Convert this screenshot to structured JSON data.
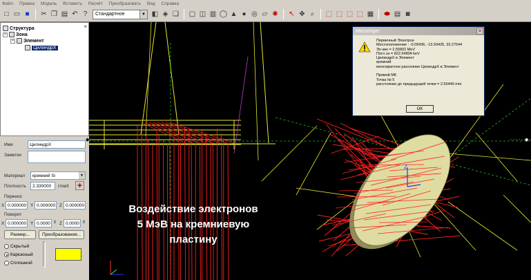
{
  "menu": [
    "Файл",
    "Правка",
    "Модель",
    "Вставить",
    "Расчёт",
    "Преобразовать",
    "Вид",
    "Справка"
  ],
  "toolbar": {
    "mode_value": "Стандартное"
  },
  "tree": {
    "root": "Структура",
    "zone": "Зона",
    "element": "Элемент",
    "cylinder": "ЦилиндрХ"
  },
  "props": {
    "name_label": "Имя",
    "name_value": "ЦилиндрХ",
    "notes_label": "Заметки",
    "notes_value": "",
    "material_label": "Материал",
    "material_value": "кремний Si",
    "density_label": "Плотность",
    "density_value": "2.330000",
    "density_unit": "г/см3",
    "transfer_label": "Перенос",
    "tx_label": "X",
    "tx_value": "0.000000",
    "ty_label": "Y",
    "ty_value": "0.000000",
    "tz_label": "Z",
    "tz_value": "0.000000",
    "rotate_label": "Поворот",
    "rx_label": "X",
    "rx_value": "0.000000",
    "ry_label": "Y",
    "ry_value": "0.0000",
    "rz_label": "Z",
    "rz_value": "0.0000",
    "size_button": "Размер...",
    "transform_button": "Преобразования...",
    "radio_hidden": "Скрытый",
    "radio_wire": "Каркасный",
    "radio_solid": "Сплошной",
    "color_swatch": "#ffff00"
  },
  "caption": {
    "line1": "Воздействие электронов",
    "line2": "5 МэВ на кремниевую",
    "line3": "пластину"
  },
  "dialog": {
    "title": "Messenger",
    "lines": [
      "Первичный Электрон",
      "Местоположение : -0.09436, -13.93435, 33.27544",
      "Эн кин =      2.55802 MeV",
      "Погл эн =     822.64804 keV",
      "ЦилиндрХ в Элемент",
      "кремний",
      "многократное рассеяние ЦилиндрХ в Элемент",
      "",
      "Прямой МК",
      "Точка № 5",
      "расстояние до предыдущей точки =      2.55449 mm"
    ],
    "ok": "OK"
  },
  "viewport": {
    "axis_z": "Z"
  },
  "colors": {
    "track": "#ff2020",
    "geometry": "#e8e830",
    "disk": "#dedca0",
    "axis_green": "#20c020",
    "axis_blue": "#3030ff"
  }
}
